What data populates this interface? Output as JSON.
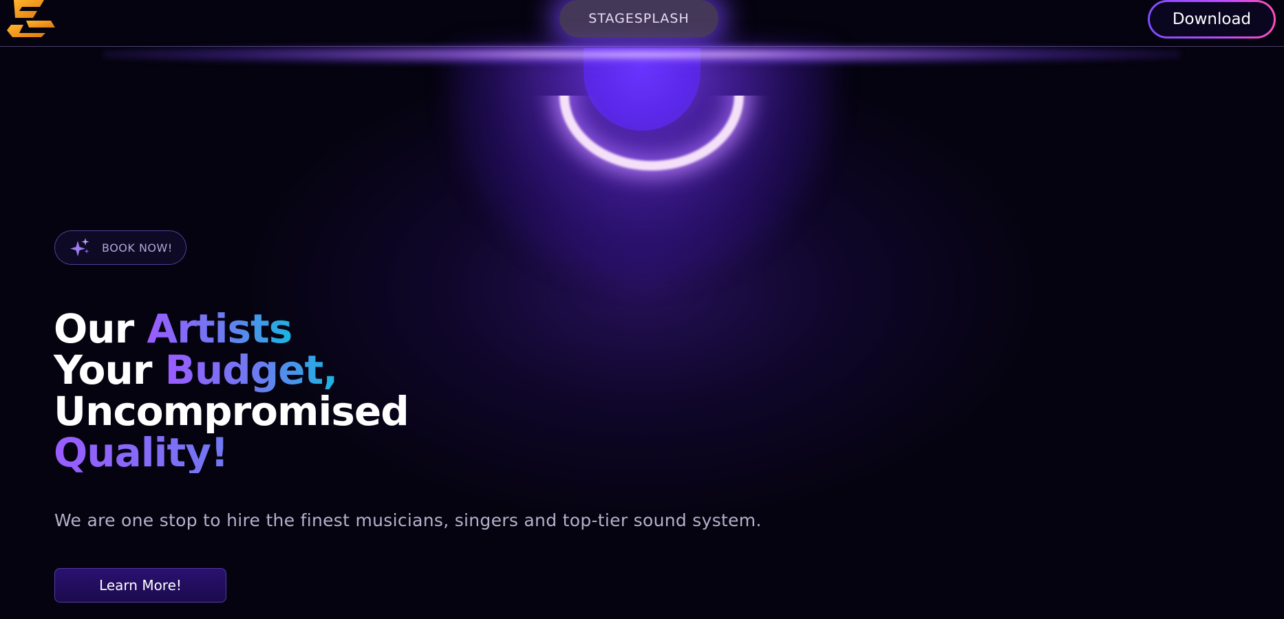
{
  "header": {
    "brand": "STAGESPLASH",
    "download_label": "Download",
    "logo_icon": "stagesplash-logo-icon"
  },
  "hero": {
    "badge_label": "BOOK NOW!",
    "badge_icon": "sparkle-icon",
    "headline": {
      "line1_plain": "Our ",
      "line1_accent": "Artists",
      "line2_plain": "Your ",
      "line2_accent": "Budget,",
      "line3_plain": "Uncompromised",
      "line4_accent": "Quality!"
    },
    "subtitle": "We are one stop to hire the finest musicians, singers and top-tier sound system.",
    "cta_label": "Learn More!"
  },
  "colors": {
    "background": "#05030f",
    "glow": "#6a35ff",
    "accent_purple": "#9a5cff",
    "accent_cyan": "#19b6e0",
    "logo_orange": "#f0a020"
  }
}
